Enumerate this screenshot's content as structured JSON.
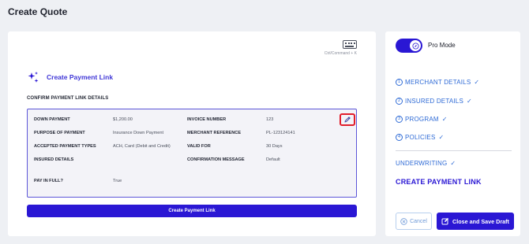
{
  "page": {
    "title": "Create Quote"
  },
  "shortcut": {
    "caption": "Ctrl/Command + K"
  },
  "section": {
    "title": "Create Payment Link",
    "subheading": "CONFIRM PAYMENT LINK DETAILS"
  },
  "details": {
    "down_payment": {
      "label": "DOWN PAYMENT",
      "value": "$1,200.00"
    },
    "purpose": {
      "label": "PURPOSE OF PAYMENT",
      "value": "Insurance Down Payment"
    },
    "accepted_types": {
      "label": "ACCEPTED PAYMENT TYPES",
      "value": "ACH, Card (Debit and Credit)"
    },
    "insured": {
      "label": "INSURED DETAILS",
      "value": ""
    },
    "pay_in_full": {
      "label": "PAY IN FULL?",
      "value": "True"
    },
    "invoice_number": {
      "label": "INVOICE NUMBER",
      "value": "123"
    },
    "merchant_reference": {
      "label": "MERCHANT REFERENCE",
      "value": "PL-123124141"
    },
    "valid_for": {
      "label": "VALID FOR",
      "value": "30 Days"
    },
    "confirmation_message": {
      "label": "CONFIRMATION MESSAGE",
      "value": "Default"
    }
  },
  "actions": {
    "create_link": "Create Payment Link"
  },
  "sidebar": {
    "pro_mode_label": "Pro Mode",
    "pro_mode_on": true,
    "steps": [
      {
        "num": "1",
        "label": "MERCHANT DETAILS",
        "done": true
      },
      {
        "num": "2",
        "label": "INSURED DETAILS",
        "done": true
      },
      {
        "num": "3",
        "label": "PROGRAM",
        "done": true
      },
      {
        "num": "4",
        "label": "POLICIES",
        "done": true
      }
    ],
    "underwriting": {
      "label": "UNDERWRITING",
      "done": true
    },
    "current_step": "CREATE PAYMENT LINK",
    "cancel_label": "Cancel",
    "save_label": "Close and Save Draft"
  },
  "colors": {
    "accent": "#2a17d4",
    "step_blue": "#2f6bd6",
    "highlight_red": "#e11d2b"
  }
}
